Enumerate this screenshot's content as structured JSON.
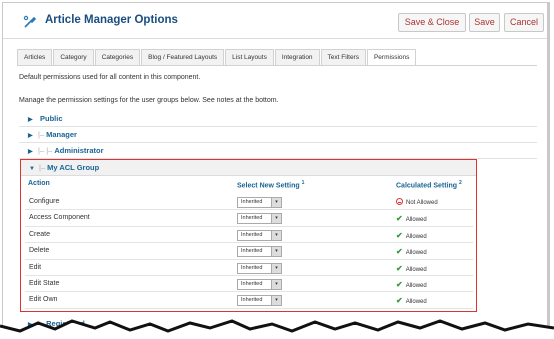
{
  "header": {
    "title": "Article Manager Options",
    "buttons": {
      "save_close": "Save & Close",
      "save": "Save",
      "cancel": "Cancel"
    }
  },
  "tabs": [
    "Articles",
    "Category",
    "Categories",
    "Blog / Featured Layouts",
    "List Layouts",
    "Integration",
    "Text Filters",
    "Permissions"
  ],
  "active_tab": "Permissions",
  "intro": {
    "line1": "Default permissions used for all content in this component.",
    "line2": "Manage the permission settings for the user groups below. See notes at the bottom."
  },
  "groups": {
    "public": {
      "tree": "",
      "label": "Public"
    },
    "manager": {
      "tree": "|–",
      "label": "Manager"
    },
    "administrator": {
      "tree": "|– |–",
      "label": "Administrator"
    },
    "acl": {
      "tree": "|–",
      "label": "My ACL Group"
    },
    "registered": {
      "tree": "|–",
      "label": "Registered"
    }
  },
  "acl_table": {
    "col_action": "Action",
    "col_select": "Select New Setting",
    "col_select_note": "1",
    "col_calc": "Calculated Setting",
    "col_calc_note": "2",
    "rows": [
      {
        "action": "Configure",
        "setting": "Inherited",
        "calculated": "Not Allowed",
        "status": "denied"
      },
      {
        "action": "Access Component",
        "setting": "Inherited",
        "calculated": "Allowed",
        "status": "allowed"
      },
      {
        "action": "Create",
        "setting": "Inherited",
        "calculated": "Allowed",
        "status": "allowed"
      },
      {
        "action": "Delete",
        "setting": "Inherited",
        "calculated": "Allowed",
        "status": "allowed"
      },
      {
        "action": "Edit",
        "setting": "Inherited",
        "calculated": "Allowed",
        "status": "allowed"
      },
      {
        "action": "Edit State",
        "setting": "Inherited",
        "calculated": "Allowed",
        "status": "allowed"
      },
      {
        "action": "Edit Own",
        "setting": "Inherited",
        "calculated": "Allowed",
        "status": "allowed"
      }
    ]
  },
  "colors": {
    "link": "#1a6496",
    "highlight_border": "#dd3333",
    "allowed": "#3a9a3a",
    "denied": "#dd3333"
  },
  "icons": {
    "header": "wrench-icon",
    "allowed": "checkmark-icon",
    "denied": "no-entry-icon",
    "collapsed": "triangle-right-icon",
    "expanded": "triangle-down-icon"
  }
}
